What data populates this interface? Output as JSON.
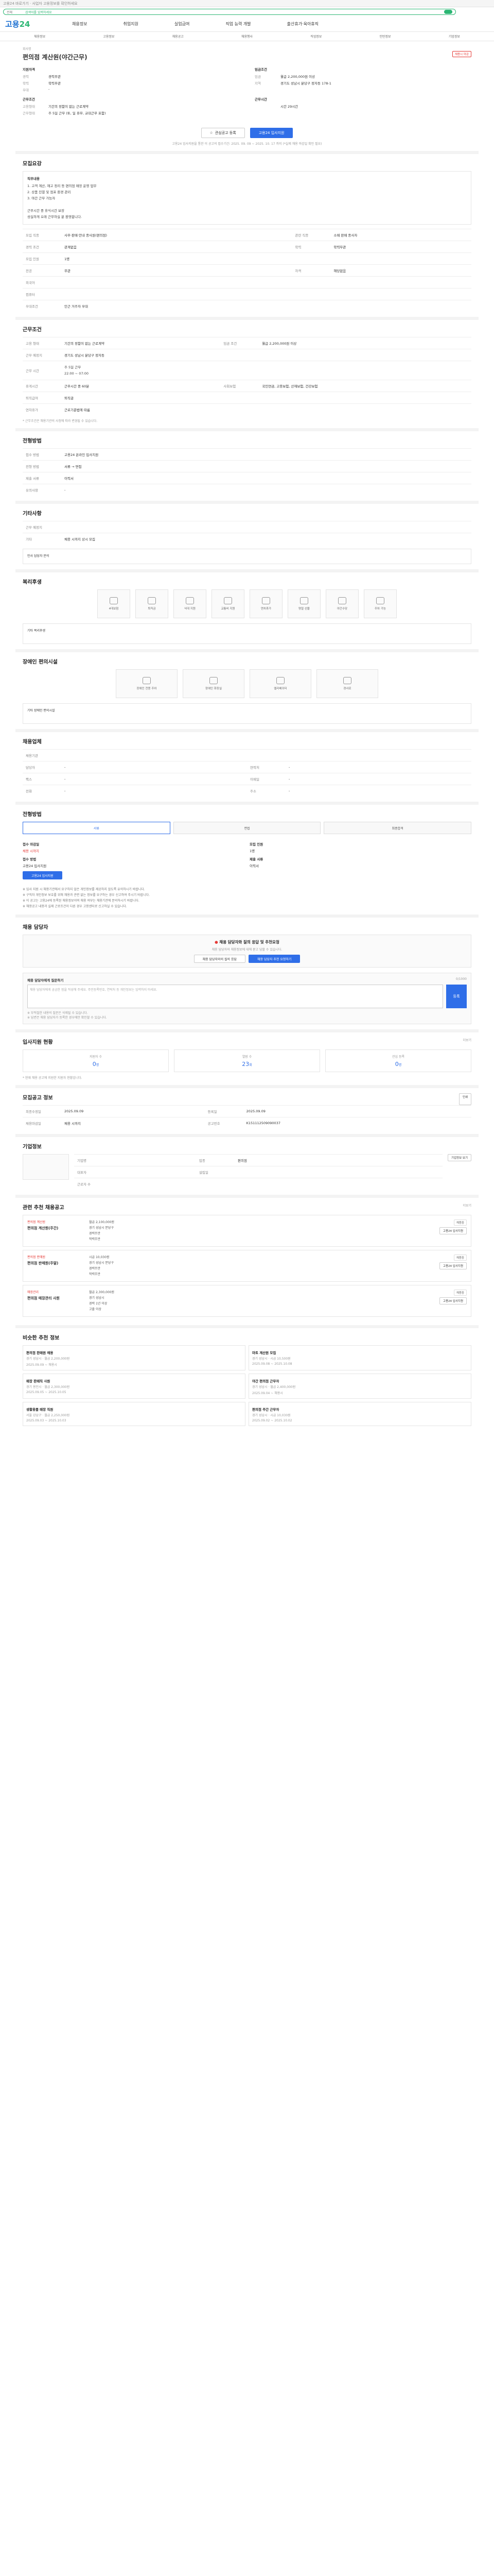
{
  "topbar": {
    "text": "고용24 바로가기 · 사업자 고용정보를 확인하세요"
  },
  "search": {
    "scope": "전체",
    "placeholder": "검색어를 입력하세요"
  },
  "header": {
    "logo_main": "고용",
    "logo_sub": "24",
    "menu": [
      "채용정보",
      "취업지원",
      "실업급여",
      "직업 능력 개발",
      "출산휴가·육아휴직"
    ]
  },
  "subnav": [
    "채용정보",
    "고용정보",
    "채용공고",
    "채용행사",
    "직업정보",
    "인턴정보",
    "기업정보"
  ],
  "job": {
    "title": "편의점 계산원(야간근무)",
    "company_label": "회사명",
    "company": "",
    "status": "채용 중",
    "badge": "채용시 마감",
    "left": {
      "h": "지원자격",
      "rows": [
        {
          "k": "경력",
          "v": "경력무관"
        },
        {
          "k": "학력",
          "v": "학력무관"
        },
        {
          "k": "우대",
          "v": "-"
        }
      ]
    },
    "left2": {
      "h": "근무조건",
      "rows": [
        {
          "k": "고용형태",
          "v": "기간의 정함이 없는 근로계약"
        },
        {
          "k": "근무형태",
          "v": "주 5일 근무 (토, 일 휴무, 교대근무 포함)"
        }
      ]
    },
    "right": {
      "h": "임금조건",
      "rows": [
        {
          "k": "임금",
          "v": "월급 2,200,000원 이상"
        },
        {
          "k": "지역",
          "v": "경기도 성남시 분당구 정자동 178-1"
        }
      ]
    },
    "right2": {
      "h": "근무시간",
      "rows": [
        {
          "k": "",
          "v": "시간 29시간"
        }
      ]
    },
    "apply_label": "관심공고 등록",
    "apply2_label": "고용24 입사지원",
    "note": "고용24 입사지원을 통한 이 공고의 접수기간: 2025. 09. 09 ~ 2025. 10. 17 까지 (*실제 채용 마감일 확인 필요)"
  },
  "recruit": {
    "title": "모집요강",
    "duty_h": "직무내용",
    "duty": "1. 고객 계산, 재고 정리 등 편의점 매장 운영 업무\n2. 상품 진열 및 점포 환경 관리\n3. 야간 근무 가능자\n\n근무시간 중 휴식시간 보장\n성실하게 오래 근무하실 분 환영합니다.",
    "rows": [
      {
        "k": "모집 직종",
        "v": "사무·판매·안내 종사원(편의점)",
        "k2": "관련 직종",
        "v2": "소매 판매 종사자"
      },
      {
        "k": "경력 조건",
        "v": "관계없음",
        "k2": "학력",
        "v2": "학력무관"
      },
      {
        "k": "모집 인원",
        "v": "1명",
        "k2": "",
        "v2": ""
      },
      {
        "k": "전공",
        "v": "무관",
        "k2": "자격",
        "v2": "해당없음"
      },
      {
        "k": "외국어",
        "v": "",
        "k2": "",
        "v2": ""
      },
      {
        "k": "컴퓨터",
        "v": "",
        "k2": "",
        "v2": ""
      },
      {
        "k": "우대조건",
        "v": "인근 거주자 우대",
        "k2": "",
        "v2": ""
      }
    ]
  },
  "conditions": {
    "title": "근무조건",
    "rows": [
      {
        "k": "고용 형태",
        "v": "기간의 정함이 없는 근로계약",
        "k2": "임금 조건",
        "v2": "월급 2,200,000원 이상"
      },
      {
        "k": "근무 예정지",
        "v": "경기도 성남시 분당구 정자동",
        "k2": "",
        "v2": ""
      },
      {
        "k": "근무 시간",
        "v": "주 5일 근무\n22:00 ~ 07:00",
        "k2": "",
        "v2": ""
      },
      {
        "k": "휴게시간",
        "v": "근무시간 중 60분",
        "k2": "사회보험",
        "v2": "국민연금, 고용보험, 산재보험, 건강보험"
      },
      {
        "k": "퇴직급여",
        "v": "퇴직금",
        "k2": "",
        "v2": ""
      },
      {
        "k": "연차휴가",
        "v": "근로기준법에 따름",
        "k2": "",
        "v2": ""
      }
    ],
    "note": "* 근무조건은 채용기관의 사정에 따라 변경될 수 있습니다."
  },
  "selection": {
    "title": "전형방법",
    "rows": [
      {
        "k": "접수 방법",
        "v": "고용24 온라인 입사지원"
      },
      {
        "k": "전형 방법",
        "v": "서류 → 면접"
      },
      {
        "k": "제출 서류",
        "v": "이력서"
      },
      {
        "k": "유의사항",
        "v": "-"
      }
    ]
  },
  "other": {
    "title": "기타사항",
    "rows": [
      {
        "k": "근무 예정지",
        "v": ""
      },
      {
        "k": "기타",
        "v": "채용 시까지 상시 모집"
      }
    ],
    "subtitle": "인사 담당자 문의"
  },
  "welfare": {
    "title": "복리후생",
    "items": [
      "4대보험",
      "퇴직금",
      "식대 지원",
      "교통비 지원",
      "연차휴가",
      "명절 선물",
      "야간수당",
      "주차 가능"
    ],
    "note": "기타 복리후생"
  },
  "disabled": {
    "title": "장애인 편의시설",
    "items": [
      "장애인 전용 주차",
      "장애인 화장실",
      "엘리베이터",
      "경사로"
    ],
    "note": "기타 장애인 편의시설"
  },
  "agency": {
    "title": "채용업체",
    "rows": [
      {
        "k": "채용기관",
        "v": ""
      },
      {
        "k": "담당자",
        "v": "-",
        "k2": "연락처",
        "v2": "-"
      },
      {
        "k": "팩스",
        "v": "-",
        "k2": "이메일",
        "v2": "-"
      },
      {
        "k": "전화",
        "v": "-",
        "k2": "주소",
        "v2": "-"
      }
    ]
  },
  "process": {
    "title": "전형방법",
    "steps": [
      "서류",
      "면접",
      "최종합격"
    ]
  },
  "apply": {
    "h1": "접수 마감일",
    "v1": "채용 시까지",
    "h2": "접수 방법",
    "v2": "고용24 입사지원",
    "btn": "고용24 입사지원",
    "h3": "모집 인원",
    "v3": "1명",
    "h4": "제출 서류",
    "v4": "이력서"
  },
  "notices": [
    "※ 입사 지원 시 채용기관에서 요구하지 않은 개인정보를 제공하지 않도록 유의하시기 바랍니다.",
    "※ 구직자 개인정보 보호를 위해 채용과 관련 없는 정보를 요구하는 경우 신고하여 주시기 바랍니다.",
    "※ 이 공고는 고용24에 등록된 채용정보이며 채용 여부는 채용기관에 문의하시기 바랍니다.",
    "※ 채용공고 내용과 실제 근로조건이 다른 경우 고용센터로 신고하실 수 있습니다."
  ],
  "qa": {
    "title": "채용 담당자",
    "banner": "채용 담당자와 질의 응답 및 추천요청",
    "sub": "채용 담당자와 채용정보에 대해 묻고 답할 수 있습니다.",
    "btn1": "채용 담당자와의 질의 응답",
    "btn2": "채용 담당자 추천 요청하기",
    "inq_title": "채용 담당자에게 질문하기",
    "placeholder": "채용 담당자에게 궁금한 점을 작성해 주세요. 주민등록번호, 연락처 등 개인정보는 입력하지 마세요.",
    "submit": "등록",
    "count": "0/1000",
    "note1": "※ 부적절한 내용의 질문은 삭제될 수 있습니다.",
    "note2": "※ 답변은 채용 담당자가 등록한 경우에만 확인할 수 있습니다."
  },
  "stats": {
    "title": "입사지원 현황",
    "more": "더보기",
    "items": [
      {
        "h": "지원자 수",
        "v": "0",
        "u": "명"
      },
      {
        "h": "열람 수",
        "v": "23",
        "u": "회"
      },
      {
        "h": "관심 등록",
        "v": "0",
        "u": "명"
      }
    ],
    "note": "* 현재 채용 공고에 지원한 지원자 현황입니다."
  },
  "info": {
    "title": "모집공고 정보",
    "rows": [
      {
        "k": "최종수정일",
        "v": "2025.09.09",
        "k2": "등록일",
        "v2": "2025.09.09"
      },
      {
        "k": "채용마감일",
        "v": "채용 시까지",
        "k2": "공고번호",
        "v2": "K151112509090037"
      }
    ],
    "btn": "인쇄"
  },
  "company": {
    "title": "기업정보",
    "rows": [
      {
        "k": "기업명",
        "v": "",
        "k2": "업종",
        "v2": "편의점"
      },
      {
        "k": "대표자",
        "v": "",
        "k2": "설립일",
        "v2": ""
      },
      {
        "k": "근로자 수",
        "v": "",
        "k2": "",
        "v2": ""
      }
    ],
    "btn": "기업정보 보기"
  },
  "similar": {
    "title": "관련 추천 채용공고",
    "more": "더보기",
    "items": [
      {
        "co": "편의점 계산원",
        "title": "편의점 계산원(주간)",
        "badge": "채용중",
        "info": [
          "월급 2,100,000원",
          "경기 성남시 분당구",
          "경력무관",
          "학력무관"
        ]
      },
      {
        "co": "편의점 판매원",
        "title": "편의점 판매원(주말)",
        "badge": "채용중",
        "info": [
          "시급 10,030원",
          "경기 성남시 분당구",
          "경력무관",
          "학력무관"
        ]
      },
      {
        "co": "매장관리",
        "title": "편의점 매장관리 사원",
        "badge": "채용중",
        "info": [
          "월급 2,300,000원",
          "경기 성남시",
          "경력 1년 이상",
          "고졸 이상"
        ]
      }
    ]
  },
  "recommend": {
    "title": "비슷한 추천 정보",
    "cards": [
      {
        "t": "편의점 판매원 채용",
        "d": "경기 성남시 · 월급 2,200,000원",
        "s": "2025.09.09 ~ 채용시"
      },
      {
        "t": "마트 계산원 모집",
        "d": "경기 성남시 · 시급 10,500원",
        "s": "2025.09.08 ~ 2025.10.08"
      },
      {
        "t": "매장 판매직 사원",
        "d": "경기 용인시 · 월급 2,300,000원",
        "s": "2025.09.05 ~ 2025.10.05"
      },
      {
        "t": "야간 편의점 근무자",
        "d": "경기 성남시 · 월급 2,400,000원",
        "s": "2025.09.04 ~ 채용시"
      },
      {
        "t": "생활용품 매장 직원",
        "d": "서울 강남구 · 월급 2,250,000원",
        "s": "2025.09.03 ~ 2025.10.03"
      },
      {
        "t": "편의점 주간 근무자",
        "d": "경기 성남시 · 시급 10,030원",
        "s": "2025.09.02 ~ 2025.10.02"
      }
    ]
  }
}
